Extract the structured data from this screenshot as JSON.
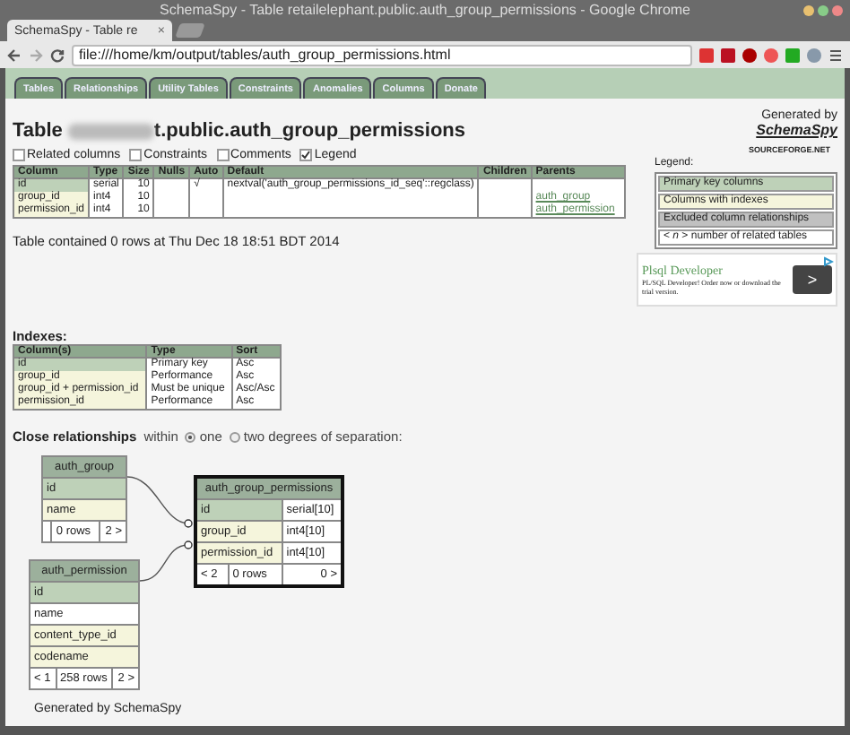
{
  "window": {
    "title": "SchemaSpy - Table retailelephant.public.auth_group_permissions - Google Chrome"
  },
  "browser": {
    "tabs": [
      {
        "label": "SchemaSpy - Table re",
        "selected": true
      }
    ],
    "close": "×",
    "url": "file:///home/km/output/tables/auth_group_permissions.html"
  },
  "nav_tabs": [
    {
      "label": "Tables",
      "selected": false
    },
    {
      "label": "Relationships",
      "selected": false
    },
    {
      "label": "Utility Tables",
      "selected": false
    },
    {
      "label": "Constraints",
      "selected": false
    },
    {
      "label": "Anomalies",
      "selected": false
    },
    {
      "label": "Columns",
      "selected": false
    },
    {
      "label": "Donate",
      "selected": false
    }
  ],
  "heading": {
    "prefix": "Table",
    "name": "t.public.auth_group_permissions"
  },
  "generated_by": {
    "label": "Generated by",
    "link": "SchemaSpy"
  },
  "options": [
    {
      "label": "Related columns",
      "checked": false
    },
    {
      "label": "Constraints",
      "checked": false
    },
    {
      "label": "Comments",
      "checked": false
    },
    {
      "label": "Legend",
      "checked": true
    }
  ],
  "columns_table": {
    "headers": [
      "Column",
      "Type",
      "Size",
      "Nulls",
      "Auto",
      "Default",
      "Children",
      "Parents"
    ],
    "rows": [
      {
        "kind": "primary",
        "cells": [
          "id",
          "serial",
          "10",
          "",
          "√",
          "nextval('auth_group_permissions_id_seq'::regclass)",
          ""
        ],
        "parents": []
      },
      {
        "kind": "indexed",
        "cells": [
          "group_id",
          "int4",
          "10",
          "",
          "",
          "",
          ""
        ],
        "parents": [
          "auth_group"
        ]
      },
      {
        "kind": "indexed",
        "cells": [
          "permission_id",
          "int4",
          "10",
          "",
          "",
          "",
          ""
        ],
        "parents": [
          "auth_permission"
        ]
      }
    ]
  },
  "row_count": "Table contained 0 rows at Thu Dec 18 18:51 BDT 2014",
  "sourceforge": "SOURCEFORGE.NET",
  "legend": {
    "title": "Legend:",
    "items": [
      {
        "kind": "primary",
        "label": "Primary key columns"
      },
      {
        "kind": "indexed",
        "label": "Columns with indexes"
      },
      {
        "kind": "excluded",
        "label": "Excluded column relationships"
      },
      {
        "kind": "plain",
        "label": "< *n* > number of related tables"
      }
    ]
  },
  "ad": {
    "title": "Plsql Developer",
    "text": "PL/SQL Developer! Order now or download the trial version.",
    "button": ">"
  },
  "indexes": {
    "title": "Indexes:",
    "headers": [
      "Column(s)",
      "Type",
      "Sort"
    ],
    "rows": [
      {
        "kind": "primary",
        "cells": [
          "id",
          "Primary key",
          "Asc"
        ]
      },
      {
        "kind": "indexed",
        "cells": [
          "group_id",
          "Performance",
          "Asc"
        ]
      },
      {
        "kind": "indexed",
        "cells": [
          "group_id + permission_id",
          "Must be unique",
          "Asc/Asc"
        ]
      },
      {
        "kind": "indexed",
        "cells": [
          "permission_id",
          "Performance",
          "Asc"
        ]
      }
    ]
  },
  "close_relationships": {
    "title": "Close relationships",
    "within": "within",
    "options": [
      {
        "label": "one",
        "selected": true
      },
      {
        "label": "two degrees of separation:",
        "selected": false
      }
    ]
  },
  "diagram": {
    "nodes": [
      {
        "name": "auth_group",
        "focus": false,
        "columns": [
          {
            "name": "id",
            "kind": "primary"
          },
          {
            "name": "name",
            "kind": "indexed"
          }
        ],
        "footer": {
          "rows": "0 rows",
          "right": "2 >"
        }
      },
      {
        "name": "auth_group_permissions",
        "focus": true,
        "columns": [
          {
            "name": "id",
            "type": "serial[10]",
            "kind": "primary"
          },
          {
            "name": "group_id",
            "type": "int4[10]",
            "kind": "indexed"
          },
          {
            "name": "permission_id",
            "type": "int4[10]",
            "kind": "indexed"
          }
        ],
        "footer": {
          "left": "< 2",
          "rows": "0 rows",
          "right": "0 >"
        }
      },
      {
        "name": "auth_permission",
        "focus": false,
        "columns": [
          {
            "name": "id",
            "kind": "primary"
          },
          {
            "name": "name",
            "kind": "plain"
          },
          {
            "name": "content_type_id",
            "kind": "indexed"
          },
          {
            "name": "codename",
            "kind": "indexed"
          }
        ],
        "footer": {
          "left": "< 1",
          "rows": "258 rows",
          "right": "2 >"
        }
      }
    ]
  },
  "footer": "Generated by SchemaSpy"
}
